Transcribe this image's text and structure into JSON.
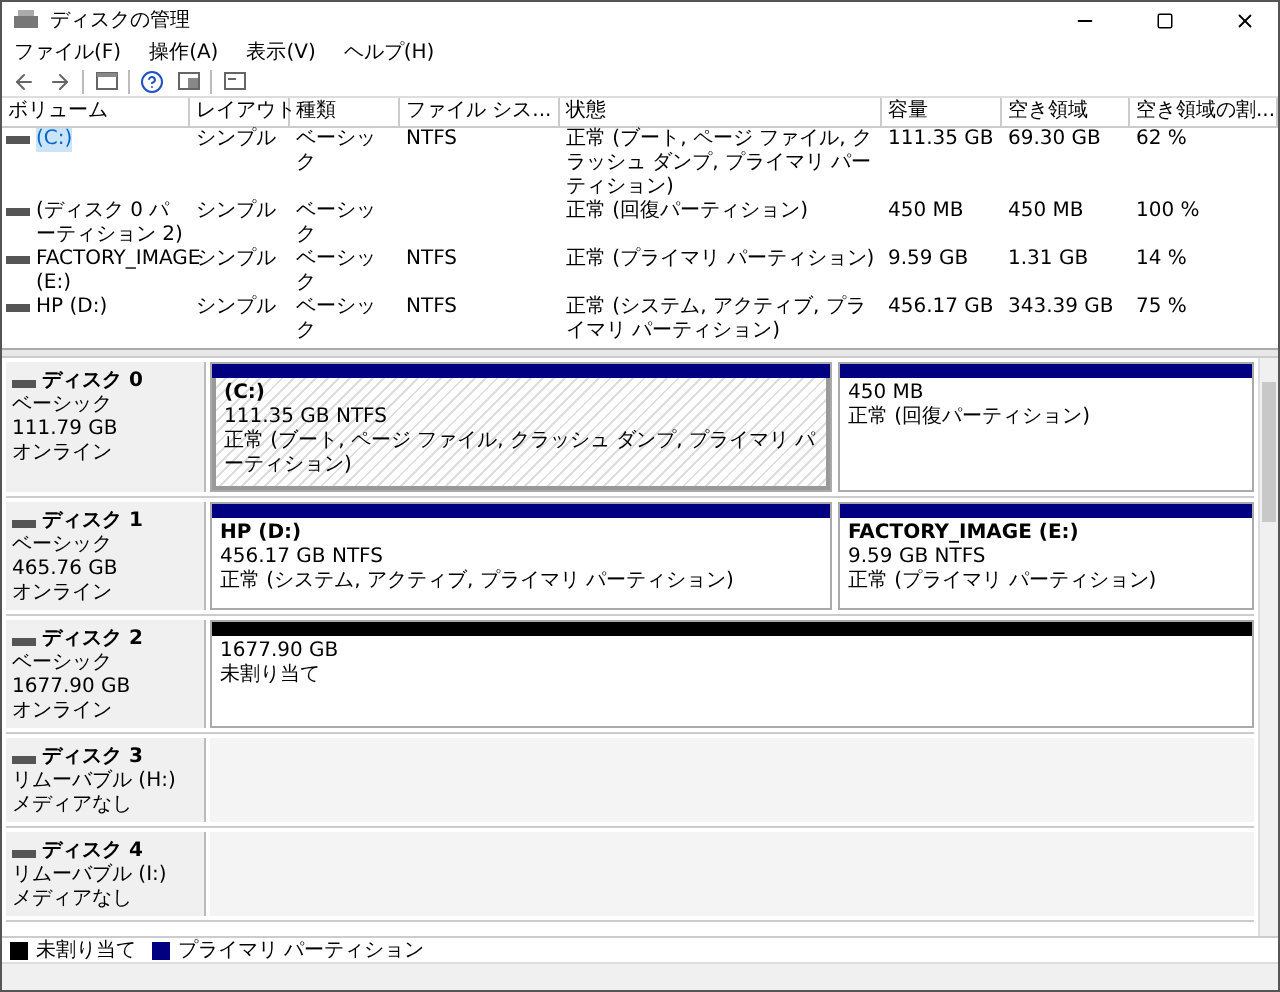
{
  "window": {
    "title": "ディスクの管理"
  },
  "menu": [
    "ファイル(F)",
    "操作(A)",
    "表示(V)",
    "ヘルプ(H)"
  ],
  "volume_table": {
    "columns": [
      "ボリューム",
      "レイアウト",
      "種類",
      "ファイル シス...",
      "状態",
      "容量",
      "空き領域",
      "空き領域の割..."
    ],
    "rows": [
      {
        "selected": true,
        "volume": "(C:)",
        "layout": "シンプル",
        "type": "ベーシック",
        "filesystem": "NTFS",
        "status": "正常 (ブート, ページ ファイル, クラッシュ ダンプ, プライマリ パーティション)",
        "capacity": "111.35 GB",
        "free": "69.30 GB",
        "free_pct": "62 %"
      },
      {
        "selected": false,
        "volume": "(ディスク 0 パーティション 2)",
        "layout": "シンプル",
        "type": "ベーシック",
        "status": "正常 (回復パーティション)",
        "capacity": "450 MB",
        "free": "450 MB",
        "free_pct": "100 %"
      },
      {
        "selected": false,
        "volume": "FACTORY_IMAGE (E:)",
        "layout": "シンプル",
        "type": "ベーシック",
        "filesystem": "NTFS",
        "status": "正常 (プライマリ パーティション)",
        "capacity": "9.59 GB",
        "free": "1.31 GB",
        "free_pct": "14 %"
      },
      {
        "selected": false,
        "volume": "HP (D:)",
        "layout": "シンプル",
        "type": "ベーシック",
        "filesystem": "NTFS",
        "status": "正常 (システム, アクティブ, プライマリ パーティション)",
        "capacity": "456.17 GB",
        "free": "343.39 GB",
        "free_pct": "75 %"
      }
    ]
  },
  "disks": [
    {
      "name": "ディスク 0",
      "type": "ベーシック",
      "size": "111.79 GB",
      "status": "オンライン",
      "partitions": [
        {
          "kind": "primary",
          "selected": true,
          "title": "(C:)",
          "size": "111.35 GB NTFS",
          "status": "正常 (ブート, ページ ファイル, クラッシュ ダンプ, プライマリ パーティション)"
        },
        {
          "kind": "primary",
          "selected": false,
          "size": "450 MB",
          "status": "正常 (回復パーティション)"
        }
      ]
    },
    {
      "name": "ディスク 1",
      "type": "ベーシック",
      "size": "465.76 GB",
      "status": "オンライン",
      "partitions": [
        {
          "kind": "primary",
          "selected": false,
          "title": "HP  (D:)",
          "size": "456.17 GB NTFS",
          "status": "正常 (システム, アクティブ, プライマリ パーティション)"
        },
        {
          "kind": "primary",
          "selected": false,
          "title": "FACTORY_IMAGE  (E:)",
          "size": "9.59 GB NTFS",
          "status": "正常 (プライマリ パーティション)"
        }
      ]
    },
    {
      "name": "ディスク 2",
      "type": "ベーシック",
      "size": "1677.90 GB",
      "status": "オンライン",
      "partitions": [
        {
          "kind": "unallocated",
          "selected": false,
          "size": "1677.90 GB",
          "status": "未割り当て"
        }
      ]
    },
    {
      "name": "ディスク 3",
      "type": "リムーバブル (H:)",
      "status": "メディアなし"
    },
    {
      "name": "ディスク 4",
      "type": "リムーバブル (I:)",
      "status": "メディアなし"
    }
  ],
  "legend": [
    {
      "label": "未割り当て",
      "color": "#000000"
    },
    {
      "label": "プライマリ パーティション",
      "color": "#000080"
    }
  ]
}
